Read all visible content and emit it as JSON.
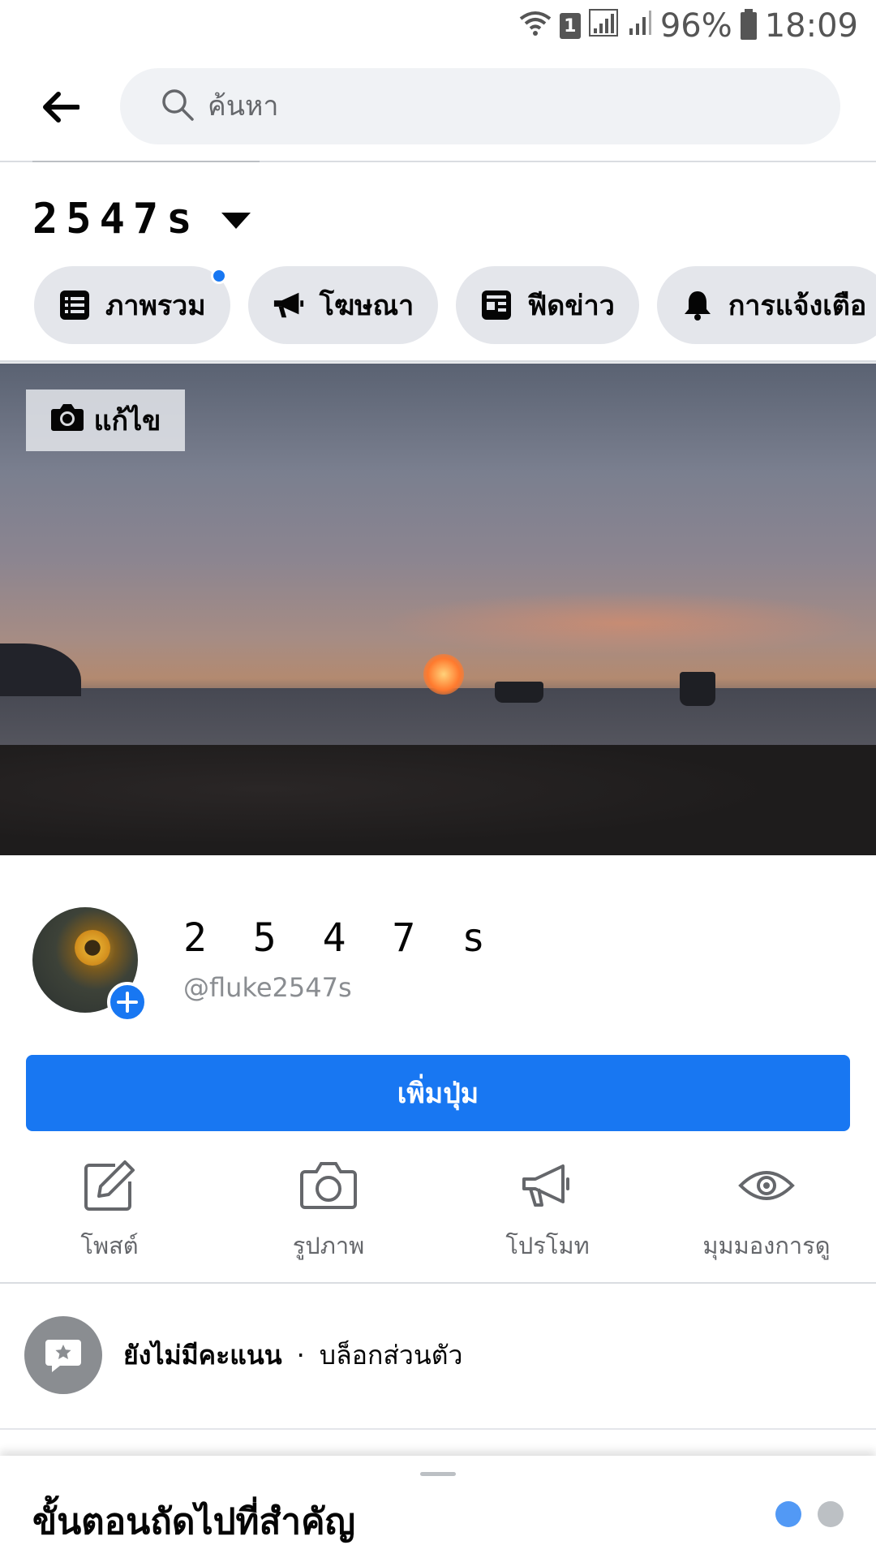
{
  "status_bar": {
    "sim_label": "1",
    "battery": "96%",
    "time": "18:09"
  },
  "header": {
    "search_placeholder": "ค้นหา"
  },
  "page": {
    "name": "2547s"
  },
  "tabs": [
    {
      "label": "ภาพรวม",
      "icon": "list-icon",
      "has_dot": true
    },
    {
      "label": "โฆษณา",
      "icon": "megaphone-icon",
      "has_dot": false
    },
    {
      "label": "ฟีดข่าว",
      "icon": "news-feed-icon",
      "has_dot": false
    },
    {
      "label": "การแจ้งเตือ",
      "icon": "bell-icon",
      "has_dot": false
    }
  ],
  "cover": {
    "edit_label": "แก้ไข"
  },
  "profile": {
    "name": "2 5 4 7 s",
    "handle": "@fluke2547s"
  },
  "primary_button": {
    "label": "เพิ่มปุ่ม"
  },
  "actions": [
    {
      "label": "โพสต์",
      "icon": "edit-icon"
    },
    {
      "label": "รูปภาพ",
      "icon": "camera-icon"
    },
    {
      "label": "โปรโมท",
      "icon": "megaphone-icon"
    },
    {
      "label": "มุมมองการดู",
      "icon": "eye-icon"
    }
  ],
  "rating": {
    "status": "ยังไม่มีคะแนน",
    "separator": "·",
    "block": "บล็อกส่วนตัว"
  },
  "bottom_sheet": {
    "title": "ขั้นตอนถัดไปที่สำคัญ",
    "pages": 2,
    "active_page": 1
  },
  "colors": {
    "accent": "#1877f2",
    "chip_bg": "#e4e6eb",
    "search_bg": "#f0f2f5",
    "muted_text": "#65676b"
  }
}
